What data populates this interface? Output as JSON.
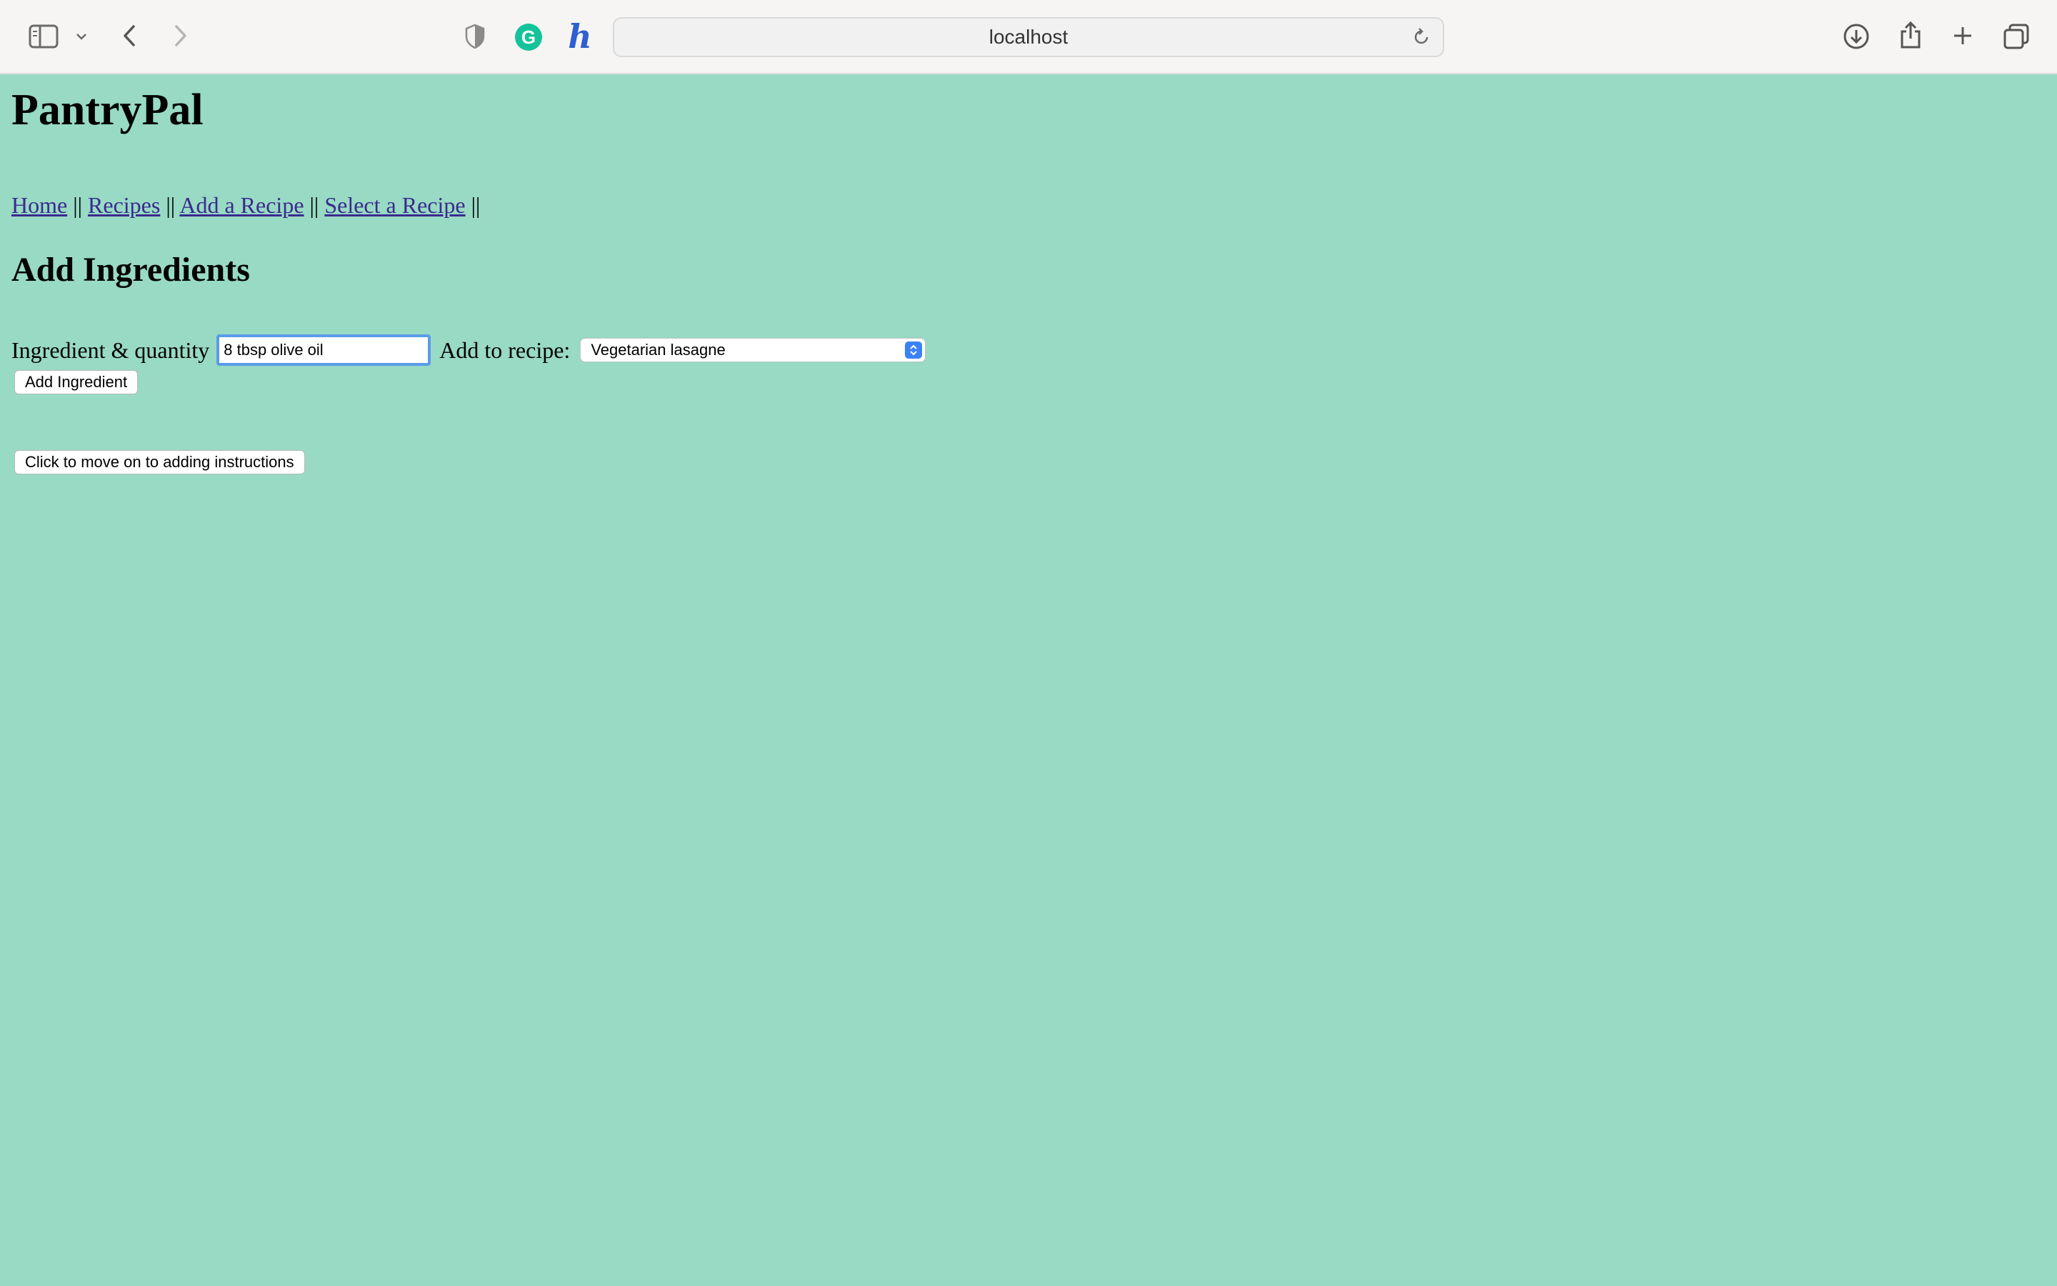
{
  "browser": {
    "address": "localhost",
    "icons": {
      "sidebar": "sidebar-icon",
      "sidebar_menu": "chevron-down-icon",
      "back": "chevron-left-icon",
      "forward": "chevron-right-icon",
      "privacy": "shield-icon",
      "grammarly": "grammarly-icon",
      "honey": "honey-icon",
      "reload": "reload-icon",
      "downloads": "download-icon",
      "share": "share-icon",
      "new_tab": "plus-icon",
      "tabs": "tab-overview-icon"
    },
    "grammarly_letter": "G",
    "honey_letter": "h"
  },
  "page": {
    "site_title": "PantryPal",
    "nav": [
      {
        "label": "Home"
      },
      {
        "label": "Recipes"
      },
      {
        "label": "Add a Recipe"
      },
      {
        "label": "Select a Recipe"
      }
    ],
    "nav_separator": "||",
    "section_title": "Add Ingredients",
    "form": {
      "ingredient_label": "Ingredient & quantity",
      "ingredient_value": "8 tbsp olive oil",
      "recipe_label": "Add to recipe:",
      "recipe_selected": "Vegetarian lasagne",
      "add_button": "Add Ingredient"
    },
    "next_button": "Click to move on to adding instructions"
  },
  "colors": {
    "page_background": "#98dac4",
    "link": "#3a2a8e",
    "focus_ring": "#5b9be8",
    "select_accent": "#3b82f6"
  }
}
